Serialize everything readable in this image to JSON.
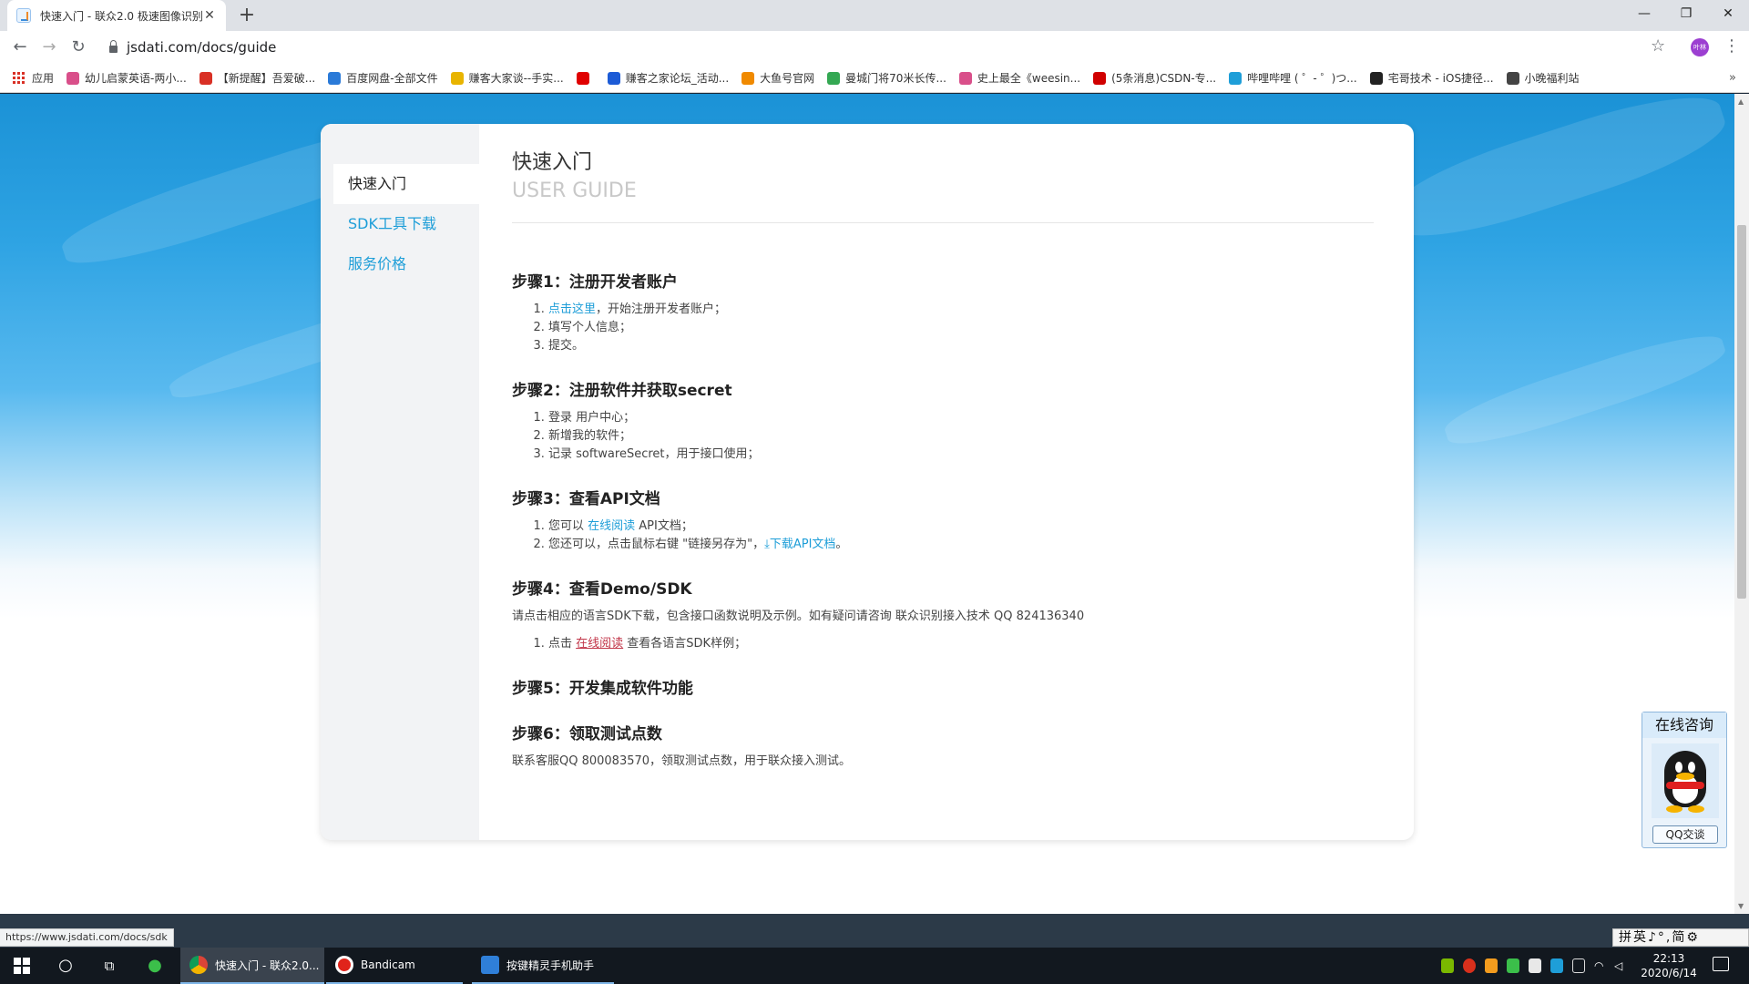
{
  "browser": {
    "tab_title": "快速入门 - 联众2.0 极速图像识别",
    "url": "jsdati.com/docs/guide",
    "profile_label": "叶林",
    "apps_label": "应用",
    "bookmarks": [
      {
        "label": "幼儿启蒙英语-两小...",
        "color": "#d94f8a"
      },
      {
        "label": "【新提醒】吾爱破...",
        "color": "#d93025"
      },
      {
        "label": "百度网盘-全部文件",
        "color": "#2a7ad8"
      },
      {
        "label": "赚客大家谈--手实...",
        "color": "#e8b400"
      },
      {
        "label": "",
        "color": "#e00000"
      },
      {
        "label": "赚客之家论坛_活动...",
        "color": "#1c5bd6"
      },
      {
        "label": "大鱼号官网",
        "color": "#f08a00"
      },
      {
        "label": "曼城门将70米长传...",
        "color": "#34a853"
      },
      {
        "label": "史上最全《weesin...",
        "color": "#d94f8a"
      },
      {
        "label": "(5条消息)CSDN-专...",
        "color": "#d00000"
      },
      {
        "label": "哔哩哔哩 ( ゜- ゜)つ...",
        "color": "#1e9ed8"
      },
      {
        "label": "宅哥技术 - iOS捷径...",
        "color": "#222222"
      },
      {
        "label": "小晚福利站",
        "color": "#444444"
      }
    ]
  },
  "guide": {
    "nav": [
      "快速入门",
      "SDK工具下载",
      "服务价格"
    ],
    "title": "快速入门",
    "subtitle": "USER GUIDE",
    "step1": {
      "heading": "步骤1：注册开发者账户",
      "item1_link": "点击这里",
      "item1_text": "，开始注册开发者账户；",
      "item2": "填写个人信息；",
      "item3": "提交。"
    },
    "step2": {
      "heading": "步骤2：注册软件并获取secret",
      "item1": "登录 用户中心；",
      "item2": "新增我的软件；",
      "item3": "记录 softwareSecret，用于接口使用；"
    },
    "step3": {
      "heading": "步骤3：查看API文档",
      "item1_pre": "您可以 ",
      "item1_link": "在线阅读",
      "item1_post": " API文档；",
      "item2_pre": "您还可以，点击鼠标右键 \"链接另存为\"，",
      "item2_link": "下载API文档",
      "item2_post": "。"
    },
    "step4": {
      "heading": "步骤4：查看Demo/SDK",
      "desc": "请点击相应的语言SDK下载，包含接口函数说明及示例。如有疑问请咨询 联众识别接入技术 QQ 824136340",
      "item1_pre": "点击 ",
      "item1_link": "在线阅读",
      "item1_post": " 查看各语言SDK样例；"
    },
    "step5": {
      "heading": "步骤5：开发集成软件功能"
    },
    "step6": {
      "heading": "步骤6：领取测试点数",
      "desc": "联系客服QQ 800083570，领取测试点数，用于联众接入测试。"
    }
  },
  "qq_widget": {
    "title": "在线咨询",
    "button": "QQ交谈"
  },
  "status_url": "https://www.jsdati.com/docs/sdk",
  "ime": "拼英♪°,简⚙",
  "taskbar": {
    "tasks": [
      "快速入门 - 联众2.0...",
      "Bandicam",
      "按键精灵手机助手"
    ],
    "time": "22:13",
    "date": "2020/6/14"
  }
}
